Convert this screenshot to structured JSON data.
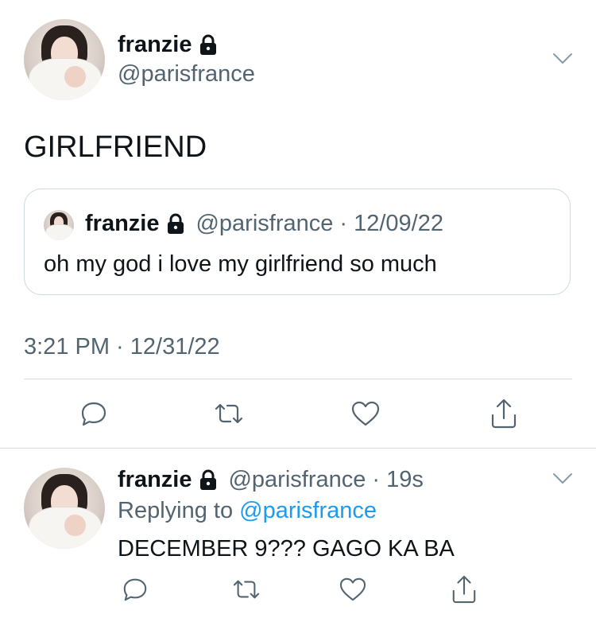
{
  "main_tweet": {
    "author_name": "franzie",
    "author_handle": "@parisfrance",
    "text": "GIRLFRIEND",
    "timestamp": "3:21 PM · 12/31/22",
    "quoted": {
      "author_name": "franzie",
      "author_handle": "@parisfrance",
      "separator": "·",
      "date": "12/09/22",
      "text": "oh my god i love my girlfriend so much"
    }
  },
  "reply": {
    "author_name": "franzie",
    "author_handle": "@parisfrance",
    "separator": "·",
    "time": "19s",
    "replying_prefix": "Replying to",
    "replying_handle": "@parisfrance",
    "text": "DECEMBER 9??? GAGO KA BA"
  },
  "icons": {
    "more": "chevron-down-icon",
    "lock": "lock-icon",
    "reply": "reply-icon",
    "retweet": "retweet-icon",
    "like": "heart-icon",
    "share": "share-icon"
  },
  "colors": {
    "text": "#0f1419",
    "secondary": "#536471",
    "link": "#1d9bf0",
    "divider": "#d8dde1"
  }
}
